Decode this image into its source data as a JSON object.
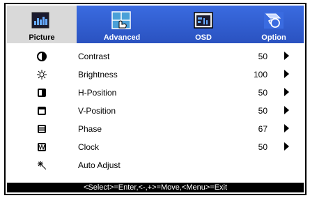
{
  "tabs": [
    {
      "label": "Picture",
      "icon": "picture-icon",
      "active": true
    },
    {
      "label": "Advanced",
      "icon": "advanced-icon",
      "active": false
    },
    {
      "label": "OSD",
      "icon": "osd-icon",
      "active": false
    },
    {
      "label": "Option",
      "icon": "option-icon",
      "active": false
    }
  ],
  "items": [
    {
      "label": "Contrast",
      "value": "50",
      "icon": "contrast-icon",
      "has_arrow": true
    },
    {
      "label": "Brightness",
      "value": "100",
      "icon": "brightness-icon",
      "has_arrow": true
    },
    {
      "label": "H-Position",
      "value": "50",
      "icon": "h-position-icon",
      "has_arrow": true
    },
    {
      "label": "V-Position",
      "value": "50",
      "icon": "v-position-icon",
      "has_arrow": true
    },
    {
      "label": "Phase",
      "value": "67",
      "icon": "phase-icon",
      "has_arrow": true
    },
    {
      "label": "Clock",
      "value": "50",
      "icon": "clock-icon",
      "has_arrow": true
    },
    {
      "label": "Auto Adjust",
      "value": "",
      "icon": "auto-adjust-icon",
      "has_arrow": false
    }
  ],
  "footer": {
    "hint": "<Select>=Enter,<-,+>=Move,<Menu>=Exit"
  },
  "colors": {
    "tab_bar": "#2a58c6",
    "active_tab": "#d9d9d9",
    "footer": "#000000"
  }
}
